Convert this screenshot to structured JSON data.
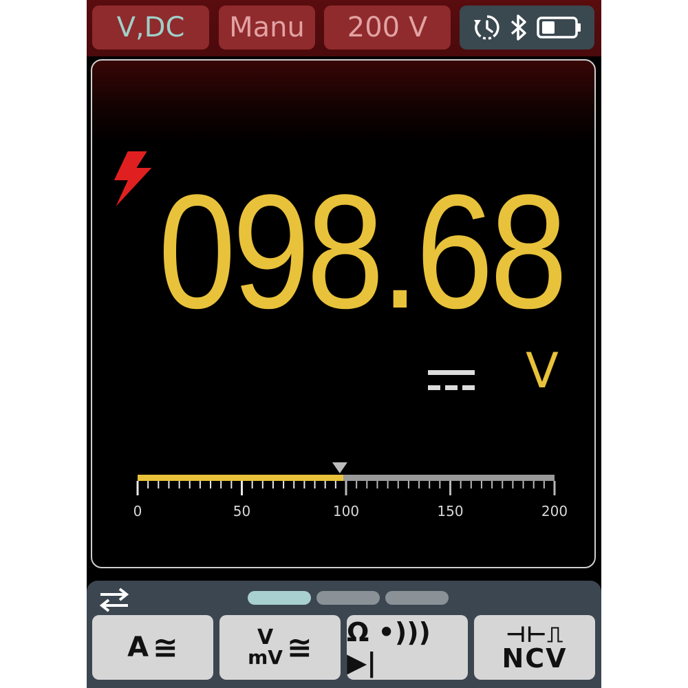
{
  "header": {
    "mode": "V,DC",
    "range_mode": "Manu",
    "range": "200 V",
    "status_icons": [
      "history-icon",
      "bluetooth-icon",
      "battery-icon"
    ]
  },
  "display": {
    "reading": "098.68",
    "unit": "V",
    "coupling_symbol": "dc-symbol",
    "warning_icon": "high-voltage-icon"
  },
  "bargraph": {
    "min": 0,
    "max": 200,
    "value": 98.68,
    "pointer": 97,
    "tick_labels": [
      "0",
      "50",
      "100",
      "150",
      "200"
    ],
    "fill_color": "#e8c23a",
    "track_color": "#9a9a9a"
  },
  "footer": {
    "swap_icon": "swap-arrows-icon",
    "pages": 3,
    "active_page": 0,
    "buttons": {
      "current": {
        "main": "A",
        "suffix": "≅"
      },
      "voltage": {
        "top": "V",
        "bottom": "mV",
        "suffix": "≅"
      },
      "resistance": {
        "main": "Ω •))) ▶|"
      },
      "capacitance": {
        "top": "⊣⊢⎍",
        "bottom": "NCV"
      }
    }
  },
  "colors": {
    "accent": "#e8c23a",
    "warning": "#e02020",
    "header_bg": "#5a0c0e",
    "pill_bg": "#8f2a2d",
    "mode_text": "#9fd0c8",
    "footer_bg": "#3c4650"
  }
}
